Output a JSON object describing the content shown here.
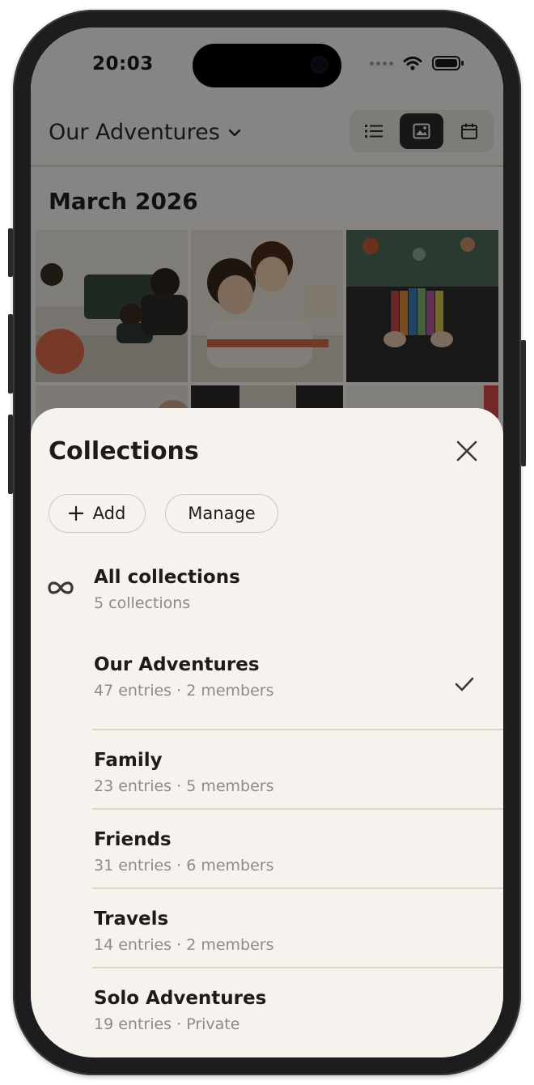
{
  "status_bar": {
    "time": "20:03"
  },
  "header": {
    "collection_title": "Our Adventures",
    "views": [
      "list-view",
      "photo-view",
      "calendar-view"
    ],
    "active_view": "photo-view"
  },
  "gallery": {
    "month_label": "March 2026"
  },
  "sheet": {
    "title": "Collections",
    "add_label": "Add",
    "manage_label": "Manage",
    "all_collections": {
      "title": "All collections",
      "subtitle": "5 collections"
    },
    "collections": [
      {
        "name": "Our Adventures",
        "meta": "47 entries · 2 members",
        "selected": true
      },
      {
        "name": "Family",
        "meta": "23 entries · 5 members",
        "selected": false
      },
      {
        "name": "Friends",
        "meta": "31 entries · 6 members",
        "selected": false
      },
      {
        "name": "Travels",
        "meta": "14 entries · 2 members",
        "selected": false
      },
      {
        "name": "Solo Adventures",
        "meta": "19 entries · Private",
        "selected": false
      }
    ]
  },
  "colors": {
    "sheet_background": "#f6f3ee",
    "primary_text": "#1e1c17",
    "secondary_text": "#8d8b86",
    "divider": "#dcd5c4"
  }
}
